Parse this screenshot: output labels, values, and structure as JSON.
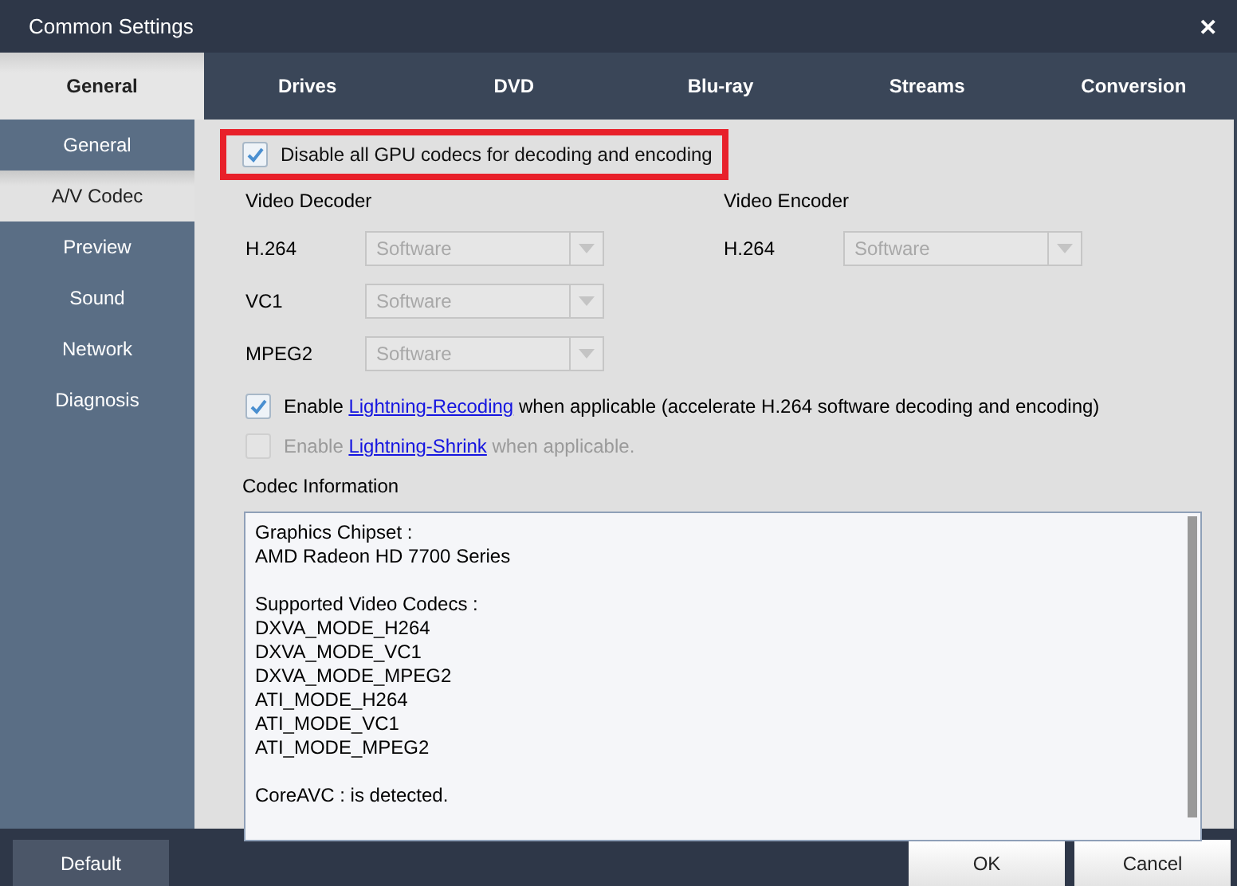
{
  "window": {
    "title": "Common Settings",
    "close": "✕"
  },
  "top_tabs": [
    {
      "label": "General",
      "selected": true
    },
    {
      "label": "Drives",
      "selected": false
    },
    {
      "label": "DVD",
      "selected": false
    },
    {
      "label": "Blu-ray",
      "selected": false
    },
    {
      "label": "Streams",
      "selected": false
    },
    {
      "label": "Conversion",
      "selected": false
    }
  ],
  "sidebar": {
    "items": [
      {
        "label": "General",
        "selected": false
      },
      {
        "label": "A/V Codec",
        "selected": true
      },
      {
        "label": "Preview",
        "selected": false
      },
      {
        "label": "Sound",
        "selected": false
      },
      {
        "label": "Network",
        "selected": false
      },
      {
        "label": "Diagnosis",
        "selected": false
      }
    ]
  },
  "gpu_option": {
    "label": "Disable all GPU codecs for decoding and encoding",
    "checked": true,
    "highlighted": true
  },
  "video_decoder": {
    "title": "Video Decoder",
    "rows": [
      {
        "label": "H.264",
        "value": "Software",
        "disabled": true
      },
      {
        "label": "VC1",
        "value": "Software",
        "disabled": true
      },
      {
        "label": "MPEG2",
        "value": "Software",
        "disabled": true
      }
    ]
  },
  "video_encoder": {
    "title": "Video Encoder",
    "rows": [
      {
        "label": "H.264",
        "value": "Software",
        "disabled": true
      }
    ]
  },
  "options": [
    {
      "prefix": "Enable ",
      "link": "Lightning-Recoding",
      "suffix": " when applicable (accelerate H.264 software decoding and encoding)",
      "checked": true,
      "disabled": false
    },
    {
      "prefix": "Enable ",
      "link": "Lightning-Shrink",
      "suffix": " when applicable.",
      "checked": false,
      "disabled": true
    }
  ],
  "codec_info": {
    "title": "Codec Information",
    "paragraphs": [
      [
        "Graphics Chipset :",
        "AMD Radeon HD 7700 Series"
      ],
      [
        "Supported Video Codecs :",
        "DXVA_MODE_H264",
        "DXVA_MODE_VC1",
        "DXVA_MODE_MPEG2",
        "ATI_MODE_H264",
        "ATI_MODE_VC1",
        "ATI_MODE_MPEG2"
      ],
      [
        "CoreAVC : is detected."
      ]
    ]
  },
  "footer": {
    "default_button": "Default",
    "ok_button": "OK",
    "cancel_button": "Cancel"
  }
}
